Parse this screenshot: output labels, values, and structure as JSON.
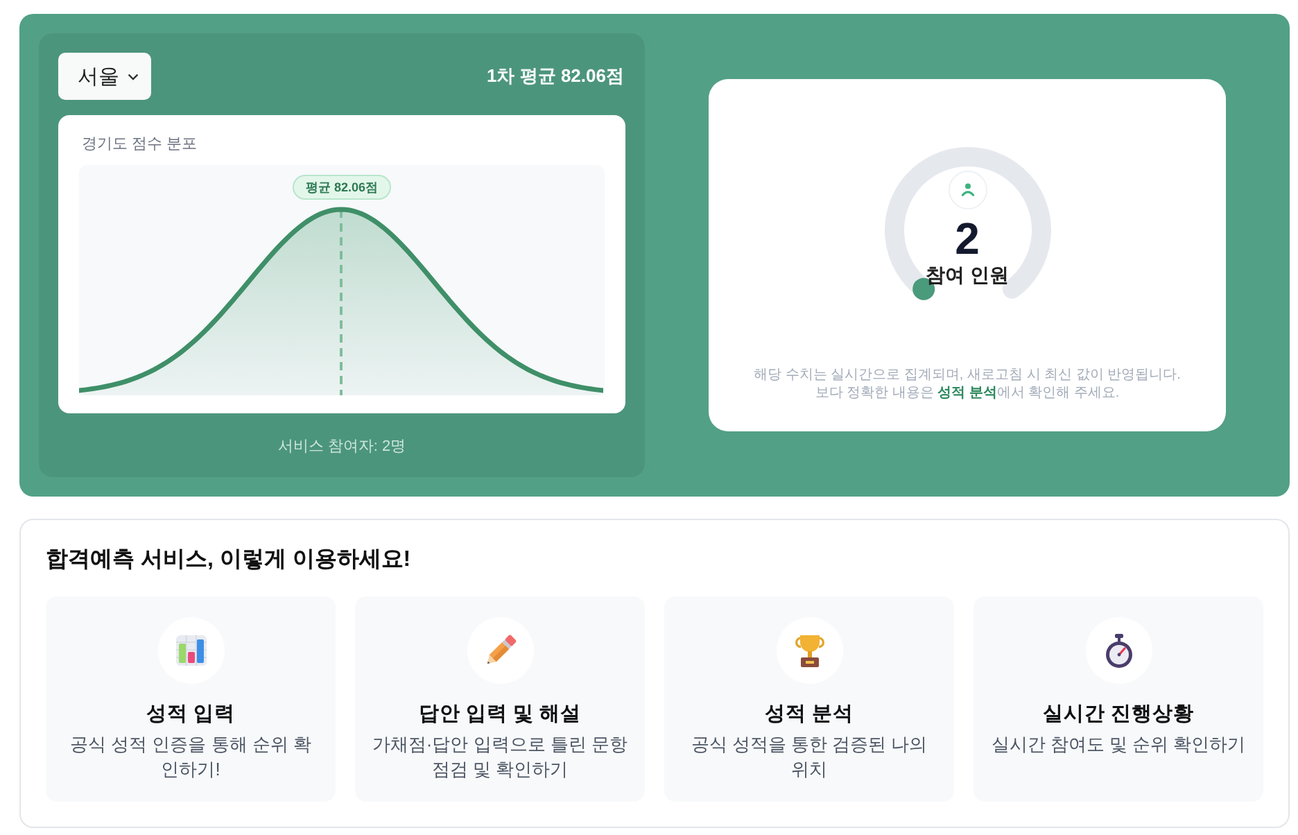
{
  "score_panel": {
    "region_select": {
      "value": "서울"
    },
    "average_summary": "1차 평균 **82.06점**",
    "distribution_card": {
      "title": "경기도 점수 분포",
      "mean_badge": "평균 82.06점"
    },
    "participants_footer": "서비스 참여자: 2명"
  },
  "participants_card": {
    "count": "2",
    "label": "참여 인원",
    "notes": [
      "해당 수치는 실시간으로 집계되며, 새로고침 시 최신 값이 반영됩니다.",
      "보다 정확한 내용은 **성적 분석**에서 확인해 주세요."
    ]
  },
  "guide": {
    "title": "합격예측 서비스, 이렇게 이용하세요!",
    "cards": [
      {
        "kind": "chart",
        "title": "성적 입력",
        "description": "공식 성적 인증을 통해 순위 확인하기!"
      },
      {
        "kind": "pencil",
        "title": "답안 입력 및 해설",
        "description": "가채점·답안 입력으로 틀린 문항 점검 및 확인하기"
      },
      {
        "kind": "trophy",
        "title": "성적 분석",
        "description": "공식 성적을 통한 검증된 나의 위치"
      },
      {
        "kind": "stopwatch",
        "title": "실시간 진행상황",
        "description": "실시간 참여도 및 순위 확인하기"
      }
    ]
  }
}
